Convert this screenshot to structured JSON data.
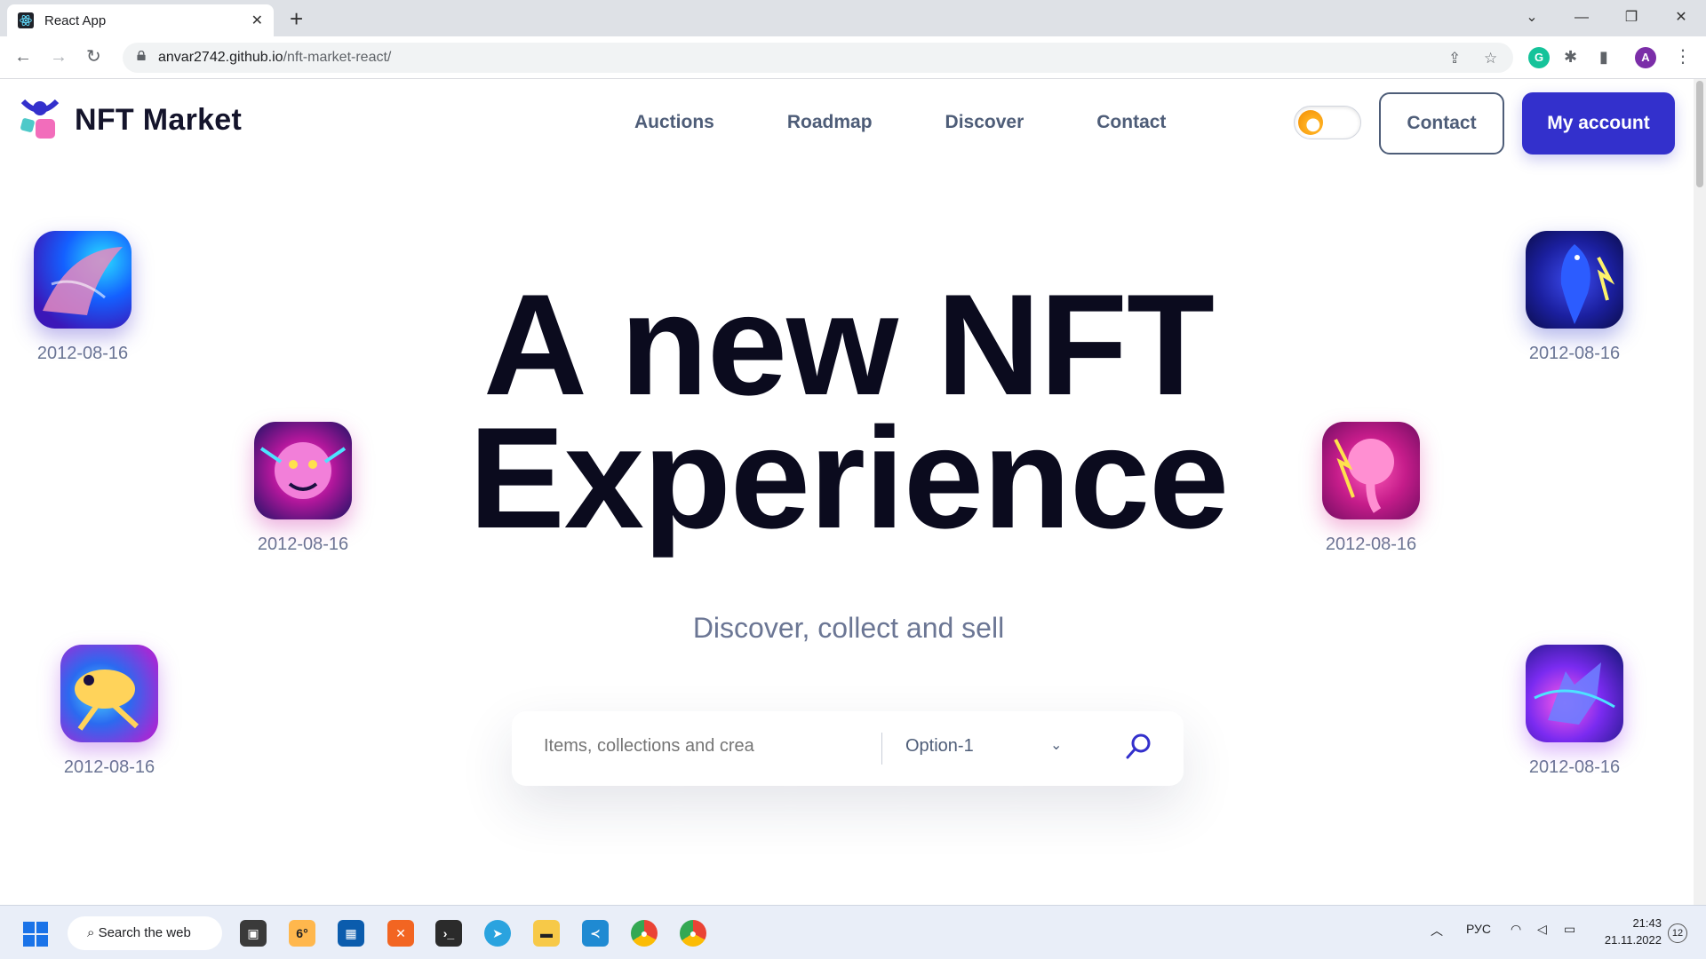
{
  "browser": {
    "tab_title": "React App",
    "url_host": "anvar2742.github.io",
    "url_path": "/nft-market-react/",
    "profile_initial": "A"
  },
  "header": {
    "logo_text": "NFT Market",
    "nav": [
      "Auctions",
      "Roadmap",
      "Discover",
      "Contact"
    ],
    "contact_button": "Contact",
    "account_button": "My account",
    "theme_toggle_state": "light"
  },
  "hero": {
    "title_line1": "A new NFT",
    "title_line2": "Experience",
    "subtitle": "Discover, collect and sell"
  },
  "search": {
    "placeholder": "Items, collections and crea",
    "selected_option": "Option-1"
  },
  "nfts": [
    {
      "date": "2012-08-16",
      "subject": "whale"
    },
    {
      "date": "2012-08-16",
      "subject": "tiger"
    },
    {
      "date": "2012-08-16",
      "subject": "frog"
    },
    {
      "date": "2012-08-16",
      "subject": "parrot"
    },
    {
      "date": "2012-08-16",
      "subject": "elephant"
    },
    {
      "date": "2012-08-16",
      "subject": "wolf"
    }
  ],
  "taskbar": {
    "search_label": "Search the web",
    "weather": "6°",
    "language": "РУС",
    "time": "21:43",
    "date": "21.11.2022",
    "notifications": "12"
  },
  "colors": {
    "accent": "#3330cc",
    "nav_text": "#4e5d78",
    "title": "#0b0b1e"
  }
}
